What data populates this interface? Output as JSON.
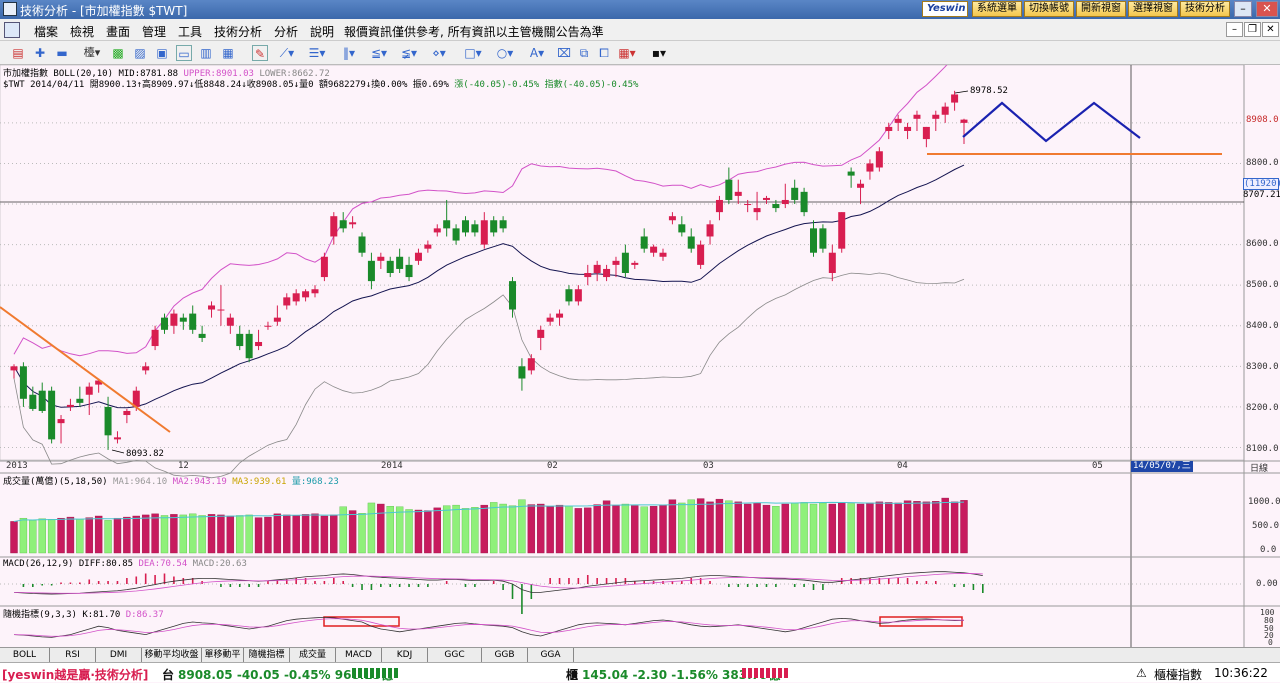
{
  "window": {
    "title": "技術分析 - [市加權指數 $TWT]",
    "min": "–",
    "max": "□",
    "close": "✕"
  },
  "title_buttons": [
    "系統選單",
    "切換帳號",
    "開新視窗",
    "選擇視窗",
    "技術分析"
  ],
  "brand": "Yeswin",
  "menu": [
    "檔案",
    "檢視",
    "畫面",
    "管理",
    "工具",
    "技術分析",
    "分析",
    "說明"
  ],
  "notice": "報價資訊僅供參考, 所有資訊以主管機關公告為準",
  "price_panel": {
    "header1_a": "市加權指數  BOLL(20,10) MID:8781.88",
    "header1_upper": "UPPER:8901.03",
    "header1_lower": "LOWER:8662.72",
    "header2": "$TWT 2014/04/11 開8900.13↑高8909.97↓低8848.24↓收8908.05↓量0 額9682279↓換0.00% 振0.69%",
    "header2_chg": "漲(-40.05)-0.45% 指數(-40.05)-0.45%",
    "high_label": "8978.52",
    "low_label": "8093.82",
    "last_price": "8908.0",
    "cursor_value_1": "(11920)",
    "cursor_value_2": "8707.21",
    "y_ticks": [
      "8900.0",
      "8800.0",
      "8700.0",
      "8600.0",
      "8500.0",
      "8400.0",
      "8300.0",
      "8200.0",
      "8100.0"
    ],
    "x_ticks": [
      "2013",
      "12",
      "2014",
      "02",
      "03",
      "04",
      "05"
    ],
    "x_cursor": "14/05/07,三",
    "period": "日線"
  },
  "volume_panel": {
    "header": "成交量(萬億)(5,18,50)",
    "ma1": "MA1:964.10",
    "ma2": "MA2:943.19",
    "ma3": "MA3:939.61",
    "vol": "量:968.23",
    "y_ticks": [
      "1000.0",
      "500.0",
      "0.0"
    ]
  },
  "macd_panel": {
    "header": "MACD(26,12,9) DIFF:80.85",
    "dea": "DEA:70.54",
    "macd": "MACD:20.63",
    "y_tick": "0.00"
  },
  "kd_panel": {
    "header": "隨機指標(9,3,3) K:81.70",
    "d": "D:86.37",
    "y_ticks": [
      "100",
      "80",
      "50",
      "20",
      "0"
    ]
  },
  "tabs": [
    "BOLL",
    "RSI",
    "DMI",
    "移動平均收盤",
    "單移動平",
    "隨機指標",
    "成交量",
    "MACD",
    "KDJ",
    "GGC",
    "GGB",
    "GGA"
  ],
  "status": {
    "brand": "[yeswin越是贏·技術分析]",
    "twse_label": "台",
    "twse": "8908.05 -40.05 -0.45% 968.23億",
    "otc_label": "櫃",
    "otc": "145.04 -2.30 -1.56% 383.79億",
    "otc_name": "櫃檯指數",
    "time": "10:36:22"
  },
  "colors": {
    "up": "#d81e50",
    "down": "#1a8a2a",
    "up_vol": "#c71b5e",
    "down_vol": "#8ff07a",
    "ma_mid": "#141450",
    "upper": "#d252c8",
    "lower": "#8a8a8a",
    "trend": "#f07a30",
    "forecast": "#1a22b0"
  },
  "chart_data": {
    "type": "candlestick",
    "title": "市加權指數 $TWT",
    "ylim": [
      8050,
      9000
    ],
    "candles": [
      {
        "o": 8290,
        "h": 8305,
        "l": 8270,
        "c": 8300
      },
      {
        "o": 8300,
        "h": 8310,
        "l": 8200,
        "c": 8220
      },
      {
        "o": 8230,
        "h": 8250,
        "l": 8190,
        "c": 8195
      },
      {
        "o": 8240,
        "h": 8260,
        "l": 8185,
        "c": 8190
      },
      {
        "o": 8240,
        "h": 8250,
        "l": 8110,
        "c": 8120
      },
      {
        "o": 8160,
        "h": 8180,
        "l": 8110,
        "c": 8170
      },
      {
        "o": 8200,
        "h": 8220,
        "l": 8190,
        "c": 8205
      },
      {
        "o": 8220,
        "h": 8250,
        "l": 8200,
        "c": 8210
      },
      {
        "o": 8230,
        "h": 8260,
        "l": 8180,
        "c": 8250
      },
      {
        "o": 8255,
        "h": 8270,
        "l": 8235,
        "c": 8265
      },
      {
        "o": 8200,
        "h": 8225,
        "l": 8094,
        "c": 8130
      },
      {
        "o": 8120,
        "h": 8140,
        "l": 8110,
        "c": 8125
      },
      {
        "o": 8180,
        "h": 8195,
        "l": 8160,
        "c": 8190
      },
      {
        "o": 8200,
        "h": 8250,
        "l": 8190,
        "c": 8240
      },
      {
        "o": 8290,
        "h": 8310,
        "l": 8280,
        "c": 8300
      },
      {
        "o": 8350,
        "h": 8400,
        "l": 8340,
        "c": 8390
      },
      {
        "o": 8420,
        "h": 8430,
        "l": 8380,
        "c": 8390
      },
      {
        "o": 8400,
        "h": 8440,
        "l": 8380,
        "c": 8430
      },
      {
        "o": 8420,
        "h": 8430,
        "l": 8390,
        "c": 8410
      },
      {
        "o": 8430,
        "h": 8450,
        "l": 8380,
        "c": 8390
      },
      {
        "o": 8380,
        "h": 8400,
        "l": 8360,
        "c": 8370
      },
      {
        "o": 8440,
        "h": 8460,
        "l": 8420,
        "c": 8450
      },
      {
        "o": 8440,
        "h": 8500,
        "l": 8400,
        "c": 8440
      },
      {
        "o": 8400,
        "h": 8430,
        "l": 8380,
        "c": 8420
      },
      {
        "o": 8380,
        "h": 8400,
        "l": 8340,
        "c": 8350
      },
      {
        "o": 8380,
        "h": 8390,
        "l": 8310,
        "c": 8320
      },
      {
        "o": 8350,
        "h": 8390,
        "l": 8340,
        "c": 8360
      },
      {
        "o": 8400,
        "h": 8410,
        "l": 8390,
        "c": 8400
      },
      {
        "o": 8410,
        "h": 8450,
        "l": 8400,
        "c": 8420
      },
      {
        "o": 8450,
        "h": 8480,
        "l": 8440,
        "c": 8470
      },
      {
        "o": 8460,
        "h": 8490,
        "l": 8450,
        "c": 8480
      },
      {
        "o": 8470,
        "h": 8490,
        "l": 8460,
        "c": 8485
      },
      {
        "o": 8480,
        "h": 8500,
        "l": 8470,
        "c": 8490
      },
      {
        "o": 8520,
        "h": 8580,
        "l": 8510,
        "c": 8570
      },
      {
        "o": 8620,
        "h": 8680,
        "l": 8600,
        "c": 8670
      },
      {
        "o": 8660,
        "h": 8680,
        "l": 8630,
        "c": 8640
      },
      {
        "o": 8650,
        "h": 8670,
        "l": 8640,
        "c": 8655
      },
      {
        "o": 8620,
        "h": 8630,
        "l": 8570,
        "c": 8580
      },
      {
        "o": 8560,
        "h": 8580,
        "l": 8490,
        "c": 8510
      },
      {
        "o": 8560,
        "h": 8580,
        "l": 8540,
        "c": 8570
      },
      {
        "o": 8560,
        "h": 8570,
        "l": 8520,
        "c": 8530
      },
      {
        "o": 8570,
        "h": 8590,
        "l": 8530,
        "c": 8540
      },
      {
        "o": 8550,
        "h": 8570,
        "l": 8510,
        "c": 8520
      },
      {
        "o": 8560,
        "h": 8590,
        "l": 8550,
        "c": 8580
      },
      {
        "o": 8590,
        "h": 8610,
        "l": 8580,
        "c": 8600
      },
      {
        "o": 8630,
        "h": 8650,
        "l": 8620,
        "c": 8640
      },
      {
        "o": 8660,
        "h": 8710,
        "l": 8620,
        "c": 8640
      },
      {
        "o": 8640,
        "h": 8650,
        "l": 8600,
        "c": 8610
      },
      {
        "o": 8660,
        "h": 8670,
        "l": 8620,
        "c": 8630
      },
      {
        "o": 8650,
        "h": 8660,
        "l": 8620,
        "c": 8630
      },
      {
        "o": 8600,
        "h": 8680,
        "l": 8590,
        "c": 8660
      },
      {
        "o": 8660,
        "h": 8670,
        "l": 8620,
        "c": 8630
      },
      {
        "o": 8660,
        "h": 8670,
        "l": 8630,
        "c": 8640
      },
      {
        "o": 8510,
        "h": 8520,
        "l": 8420,
        "c": 8440
      },
      {
        "o": 8300,
        "h": 8320,
        "l": 8240,
        "c": 8270
      },
      {
        "o": 8290,
        "h": 8330,
        "l": 8280,
        "c": 8320
      },
      {
        "o": 8370,
        "h": 8400,
        "l": 8340,
        "c": 8390
      },
      {
        "o": 8410,
        "h": 8430,
        "l": 8400,
        "c": 8420
      },
      {
        "o": 8420,
        "h": 8440,
        "l": 8400,
        "c": 8430
      },
      {
        "o": 8490,
        "h": 8500,
        "l": 8450,
        "c": 8460
      },
      {
        "o": 8460,
        "h": 8500,
        "l": 8450,
        "c": 8490
      },
      {
        "o": 8520,
        "h": 8550,
        "l": 8500,
        "c": 8530
      },
      {
        "o": 8530,
        "h": 8560,
        "l": 8510,
        "c": 8550
      },
      {
        "o": 8520,
        "h": 8550,
        "l": 8510,
        "c": 8540
      },
      {
        "o": 8550,
        "h": 8570,
        "l": 8520,
        "c": 8560
      },
      {
        "o": 8580,
        "h": 8600,
        "l": 8520,
        "c": 8530
      },
      {
        "o": 8550,
        "h": 8560,
        "l": 8540,
        "c": 8555
      },
      {
        "o": 8620,
        "h": 8640,
        "l": 8580,
        "c": 8590
      },
      {
        "o": 8580,
        "h": 8600,
        "l": 8570,
        "c": 8595
      },
      {
        "o": 8570,
        "h": 8590,
        "l": 8560,
        "c": 8580
      },
      {
        "o": 8660,
        "h": 8680,
        "l": 8650,
        "c": 8670
      },
      {
        "o": 8650,
        "h": 8670,
        "l": 8620,
        "c": 8630
      },
      {
        "o": 8620,
        "h": 8640,
        "l": 8580,
        "c": 8590
      },
      {
        "o": 8550,
        "h": 8610,
        "l": 8540,
        "c": 8600
      },
      {
        "o": 8620,
        "h": 8660,
        "l": 8600,
        "c": 8650
      },
      {
        "o": 8680,
        "h": 8720,
        "l": 8660,
        "c": 8710
      },
      {
        "o": 8760,
        "h": 8790,
        "l": 8700,
        "c": 8710
      },
      {
        "o": 8720,
        "h": 8760,
        "l": 8700,
        "c": 8730
      },
      {
        "o": 8700,
        "h": 8710,
        "l": 8680,
        "c": 8700
      },
      {
        "o": 8680,
        "h": 8730,
        "l": 8660,
        "c": 8690
      },
      {
        "o": 8710,
        "h": 8720,
        "l": 8700,
        "c": 8715
      },
      {
        "o": 8700,
        "h": 8710,
        "l": 8680,
        "c": 8690
      },
      {
        "o": 8700,
        "h": 8750,
        "l": 8690,
        "c": 8710
      },
      {
        "o": 8740,
        "h": 8760,
        "l": 8700,
        "c": 8710
      },
      {
        "o": 8730,
        "h": 8740,
        "l": 8670,
        "c": 8680
      },
      {
        "o": 8640,
        "h": 8660,
        "l": 8570,
        "c": 8580
      },
      {
        "o": 8640,
        "h": 8650,
        "l": 8580,
        "c": 8590
      },
      {
        "o": 8530,
        "h": 8600,
        "l": 8510,
        "c": 8580
      },
      {
        "o": 8590,
        "h": 8680,
        "l": 8580,
        "c": 8680
      },
      {
        "o": 8780,
        "h": 8790,
        "l": 8740,
        "c": 8770
      },
      {
        "o": 8740,
        "h": 8760,
        "l": 8700,
        "c": 8750
      },
      {
        "o": 8780,
        "h": 8810,
        "l": 8760,
        "c": 8800
      },
      {
        "o": 8790,
        "h": 8840,
        "l": 8780,
        "c": 8830
      },
      {
        "o": 8880,
        "h": 8900,
        "l": 8860,
        "c": 8890
      },
      {
        "o": 8900,
        "h": 8920,
        "l": 8880,
        "c": 8910
      },
      {
        "o": 8880,
        "h": 8900,
        "l": 8860,
        "c": 8890
      },
      {
        "o": 8910,
        "h": 8930,
        "l": 8880,
        "c": 8920
      },
      {
        "o": 8860,
        "h": 8890,
        "l": 8840,
        "c": 8890
      },
      {
        "o": 8910,
        "h": 8930,
        "l": 8880,
        "c": 8920
      },
      {
        "o": 8920,
        "h": 8950,
        "l": 8900,
        "c": 8940
      },
      {
        "o": 8950,
        "h": 8979,
        "l": 8930,
        "c": 8970
      },
      {
        "o": 8900,
        "h": 8910,
        "l": 8848,
        "c": 8908
      }
    ],
    "volume": [
      580,
      640,
      600,
      630,
      620,
      640,
      660,
      620,
      650,
      680,
      600,
      640,
      660,
      680,
      700,
      720,
      690,
      710,
      700,
      720,
      690,
      710,
      700,
      680,
      690,
      700,
      650,
      660,
      720,
      700,
      690,
      710,
      720,
      680,
      700,
      850,
      780,
      730,
      920,
      900,
      860,
      850,
      800,
      790,
      780,
      830,
      870,
      880,
      820,
      840,
      880,
      930,
      900,
      870,
      980,
      890,
      900,
      850,
      880,
      860,
      820,
      830,
      890,
      960,
      880,
      900,
      870,
      850,
      860,
      880,
      980,
      920,
      980,
      1000,
      940,
      990,
      960,
      940,
      900,
      920,
      880,
      860,
      900,
      920,
      930,
      900,
      920,
      900,
      930,
      910,
      900,
      920,
      940,
      930,
      920,
      960,
      950,
      940,
      950,
      1010,
      940,
      968
    ],
    "macd": [
      -30,
      -32,
      -34,
      -35,
      -36,
      -35,
      -34,
      -33,
      -30,
      -28,
      -26,
      -24,
      -20,
      -15,
      -8,
      -2,
      5,
      10,
      14,
      18,
      20,
      20,
      18,
      16,
      14,
      12,
      10,
      12,
      15,
      18,
      22,
      26,
      28,
      30,
      34,
      36,
      34,
      30,
      26,
      24,
      22,
      20,
      18,
      16,
      14,
      14,
      16,
      16,
      14,
      12,
      12,
      14,
      10,
      0,
      -20,
      -30,
      -30,
      -26,
      -22,
      -18,
      -14,
      -8,
      -4,
      0,
      4,
      8,
      10,
      12,
      14,
      16,
      18,
      20,
      24,
      28,
      30,
      30,
      28,
      26,
      24,
      22,
      20,
      18,
      18,
      16,
      14,
      10,
      6,
      6,
      10,
      14,
      18,
      22,
      26,
      30,
      34,
      38,
      40,
      42,
      44,
      44,
      42,
      40,
      36,
      30
    ],
    "kd": [
      30,
      28,
      25,
      22,
      20,
      25,
      30,
      40,
      50,
      60,
      55,
      45,
      40,
      35,
      30,
      40,
      50,
      60,
      70,
      75,
      72,
      70,
      65,
      60,
      55,
      50,
      55,
      60,
      70,
      80,
      85,
      88,
      90,
      92,
      90,
      85,
      80,
      75,
      60,
      50,
      45,
      40,
      45,
      50,
      55,
      60,
      65,
      70,
      72,
      68,
      65,
      62,
      60,
      55,
      40,
      30,
      25,
      35,
      45,
      55,
      65,
      70,
      72,
      70,
      68,
      65,
      70,
      75,
      80,
      82,
      78,
      72,
      65,
      60,
      58,
      60,
      62,
      65,
      60,
      55,
      50,
      45,
      40,
      45,
      55,
      65,
      75,
      85,
      88,
      86,
      80,
      75,
      70,
      72,
      78,
      82,
      85,
      86,
      84,
      82,
      80,
      81
    ]
  }
}
